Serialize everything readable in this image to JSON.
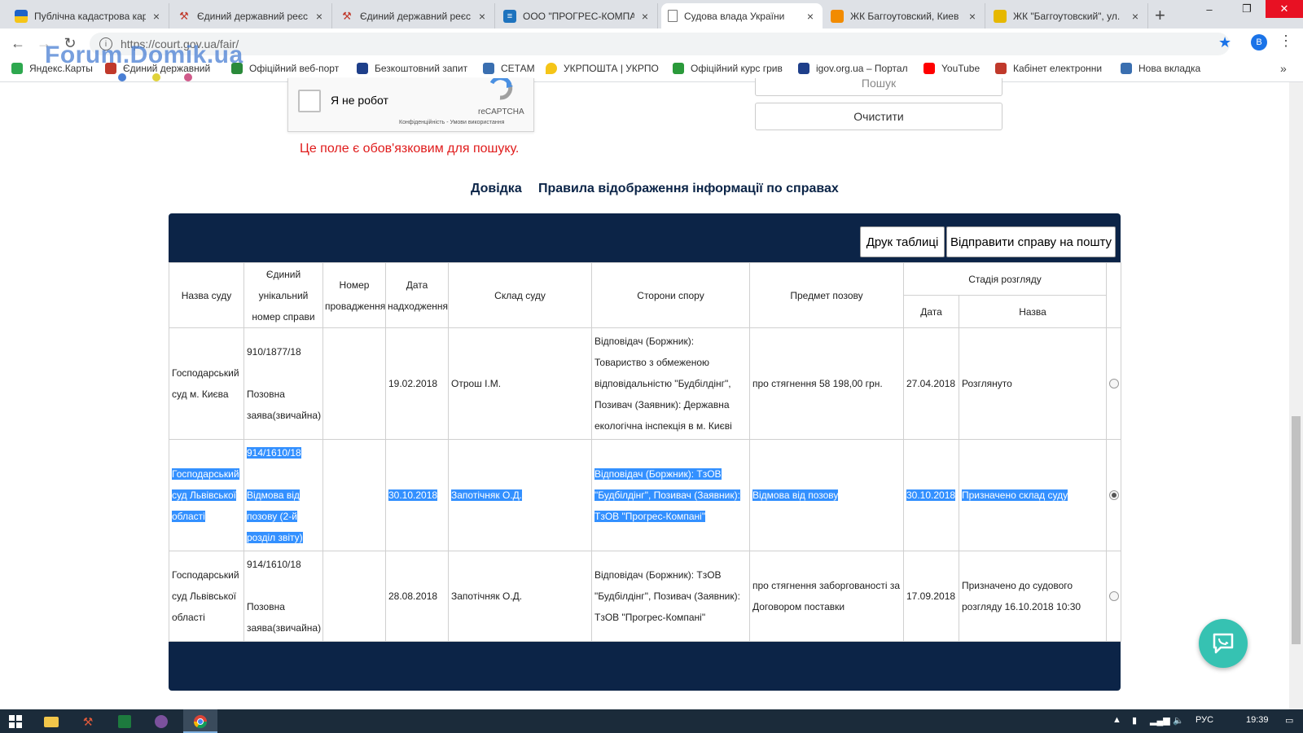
{
  "tabs": [
    {
      "title": "Публічна кадастрова кар",
      "icon": "ukraine-flag-icon",
      "color": "#f5c518"
    },
    {
      "title": "Єдиний державний реєс",
      "icon": "gavel-icon",
      "color": "#c0392b"
    },
    {
      "title": "Єдиний державний реєс",
      "icon": "gavel-icon",
      "color": "#c0392b"
    },
    {
      "title": "ООО \"ПРОГРЕС-КОМПАН",
      "icon": "company-icon",
      "color": "#1e73be"
    },
    {
      "title": "Судова влада України",
      "icon": "document-icon",
      "color": "#888888"
    },
    {
      "title": "ЖК Баггоутовский, Киев",
      "icon": "orange-square-icon",
      "color": "#f28b00"
    },
    {
      "title": "ЖК \"Баггоутовский\", ул.",
      "icon": "yellow-square-icon",
      "color": "#e6b800"
    }
  ],
  "address": {
    "url": "https://court.gov.ua/fair/",
    "profile": "B"
  },
  "watermark": "Forum.Domik.ua",
  "bookmarks": [
    {
      "label": "Яндекс.Карты",
      "color": "#2ea84f"
    },
    {
      "label": "Єдиний державний",
      "color": "#c0392b"
    },
    {
      "label": "Офіційний веб-порт",
      "color": "#2a8a3a"
    },
    {
      "label": "Безкоштовний запит",
      "color": "#1e3f8a"
    },
    {
      "label": "СЕТАМ",
      "color": "#3a6fb0"
    },
    {
      "label": "УКРПОШТА | УКРПО",
      "color": "#f5c518"
    },
    {
      "label": "Офіційний курс грив",
      "color": "#2a9a3a"
    },
    {
      "label": "igov.org.ua – Портал",
      "color": "#1e3f8a"
    },
    {
      "label": "YouTube",
      "color": "#ff0000"
    },
    {
      "label": "Кабінет електронни",
      "color": "#c0392b"
    },
    {
      "label": "Нова вкладка",
      "color": "#3a6fb0"
    }
  ],
  "captcha": {
    "label": "Я не робот",
    "brand": "reCAPTCHA",
    "legal": "Конфіденційність - Умови використання"
  },
  "form": {
    "search_label": "Пошук",
    "clear_label": "Очистити",
    "required_msg": "Це поле є обов'язковим для пошуку."
  },
  "links": {
    "help": "Довідка",
    "rules": "Правила відображення інформації по справах"
  },
  "table_buttons": {
    "print": "Друк таблиці",
    "email": "Відправити справу на пошту"
  },
  "table": {
    "headers": {
      "court": "Назва суду",
      "case_no": "Єдиний унікальний номер справи",
      "proc_no": "Номер провадження",
      "date_in": "Дата надходження",
      "judges": "Склад суду",
      "parties": "Сторони спору",
      "subject": "Предмет позову",
      "stage": "Стадія розгляду",
      "stage_date": "Дата",
      "stage_name": "Назва"
    },
    "rows": [
      {
        "court": "Господарський суд м. Києва",
        "case_no": "910/1877/18",
        "case_type": "Позовна заява(звичайна)",
        "proc_no": "",
        "date_in": "19.02.2018",
        "judges": "Отрош І.М.",
        "parties": "Відповідач (Боржник): Товариство з обмеженою відповідальністю \"Будбілдінг\", Позивач (Заявник): Державна екологічна інспекція в м. Києві",
        "subject": "про стягнення 58 198,00 грн.",
        "stage_date": "27.04.2018",
        "stage_name": "Розглянуто",
        "selected": false
      },
      {
        "court": "Господарський суд Львівської області",
        "case_no": "914/1610/18",
        "case_type": "Відмова від позову (2-й розділ звіту)",
        "proc_no": "",
        "date_in": "30.10.2018",
        "judges": "Запотічняк О.Д.",
        "parties": "Відповідач (Боржник): ТзОВ \"Будбілдінг\", Позивач (Заявник): ТзОВ \"Прогрес-Компані\"",
        "subject": "Відмова від позову",
        "stage_date": "30.10.2018",
        "stage_name": "Призначено склад суду",
        "selected": true
      },
      {
        "court": "Господарський суд Львівської області",
        "case_no": "914/1610/18",
        "case_type": "Позовна заява(звичайна)",
        "proc_no": "",
        "date_in": "28.08.2018",
        "judges": "Запотічняк О.Д.",
        "parties": "Відповідач (Боржник): ТзОВ \"Будбілдінг\", Позивач (Заявник): ТзОВ \"Прогрес-Компані\"",
        "subject": "про стягнення заборгованості за Договором поставки",
        "stage_date": "17.09.2018",
        "stage_name": "Призначено до судового розгляду 16.10.2018 10:30",
        "selected": false
      }
    ]
  },
  "taskbar": {
    "lang": "РУС",
    "time": "19:39"
  },
  "colors": {
    "panel": "#0c2447",
    "selection": "#3390ff",
    "error": "#e01b1b",
    "chat": "#36c2b2"
  }
}
